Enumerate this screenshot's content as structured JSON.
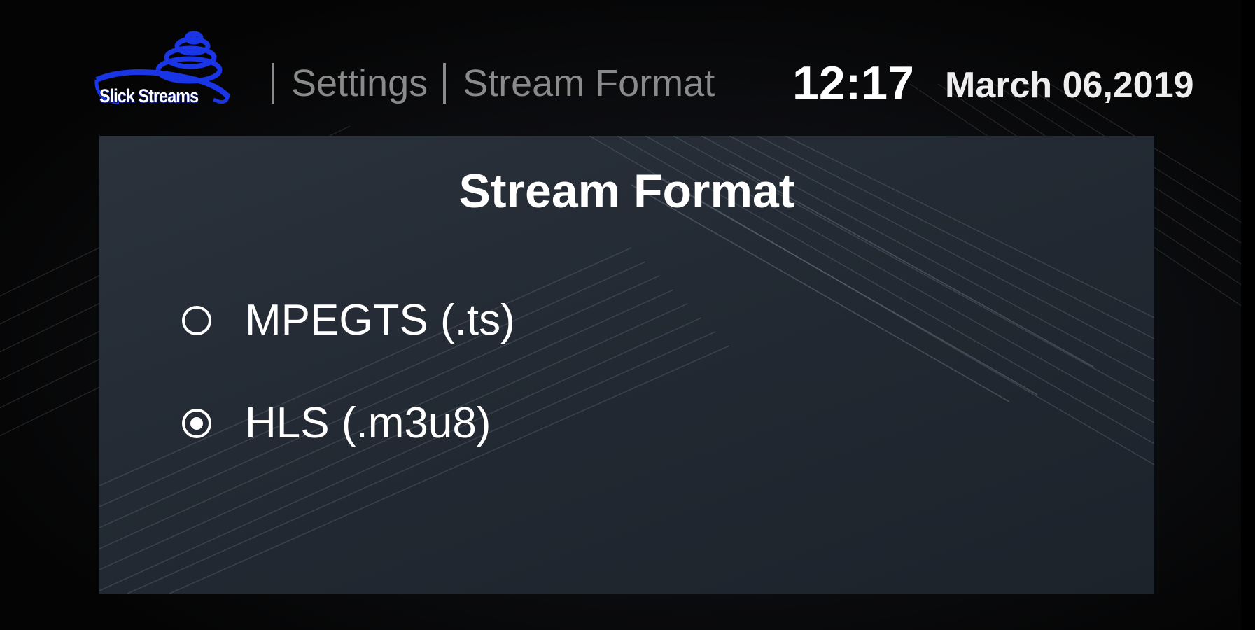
{
  "header": {
    "logo_text": "Slick Streams",
    "breadcrumb": [
      "Settings",
      "Stream Format"
    ],
    "time": "12:17",
    "date": "March 06,2019"
  },
  "panel": {
    "title": "Stream Format",
    "options": [
      {
        "label": "MPEGTS (.ts)",
        "selected": false
      },
      {
        "label": "HLS (.m3u8)",
        "selected": true
      }
    ]
  },
  "colors": {
    "logo_blue": "#1a35e6",
    "breadcrumb_gray": "#8a8a8a",
    "panel_bg": "#252b34",
    "text_white": "#ffffff"
  }
}
